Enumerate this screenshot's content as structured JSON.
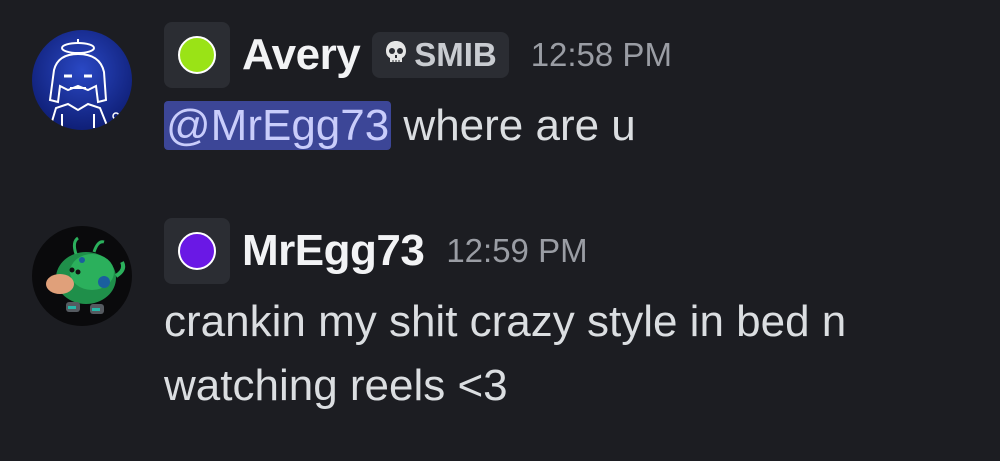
{
  "messages": [
    {
      "author": "Avery",
      "status_color": "#9ae316",
      "tag": "SMIB",
      "tag_icon": "skull-icon",
      "timestamp": "12:58 PM",
      "mention": "@MrEgg73",
      "text": " where are u"
    },
    {
      "author": "MrEgg73",
      "status_color": "#6a18e5",
      "timestamp": "12:59 PM",
      "text_line1": "crankin my shit crazy style in bed n",
      "text_line2": "watching reels <3"
    }
  ],
  "colors": {
    "background": "#1c1d22",
    "mention_bg": "#3c4697",
    "mention_text": "#c9cdfb"
  }
}
